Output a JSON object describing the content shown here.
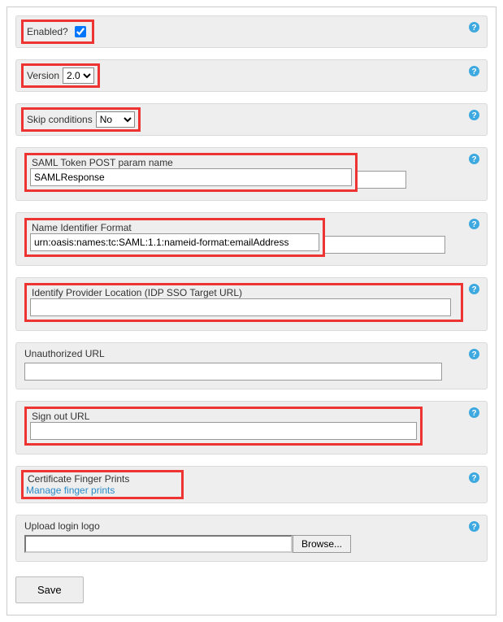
{
  "enabled": {
    "label": "Enabled?",
    "checked": true
  },
  "version": {
    "label": "Version",
    "value": "2.0",
    "options": [
      "2.0"
    ]
  },
  "skip_conditions": {
    "label": "Skip conditions",
    "value": "No",
    "options": [
      "No"
    ]
  },
  "saml_token": {
    "label": "SAML Token POST param name",
    "value": "SAMLResponse"
  },
  "name_id": {
    "label": "Name Identifier Format",
    "value": "urn:oasis:names:tc:SAML:1.1:nameid-format:emailAddress"
  },
  "idp": {
    "label": "Identify Provider Location (IDP SSO Target URL)",
    "value": ""
  },
  "unauth": {
    "label": "Unauthorized URL",
    "value": ""
  },
  "signout": {
    "label": "Sign out URL",
    "value": ""
  },
  "cert": {
    "label": "Certificate Finger Prints",
    "link": "Manage finger prints"
  },
  "logo": {
    "label": "Upload login logo",
    "browse": "Browse..."
  },
  "save": "Save"
}
